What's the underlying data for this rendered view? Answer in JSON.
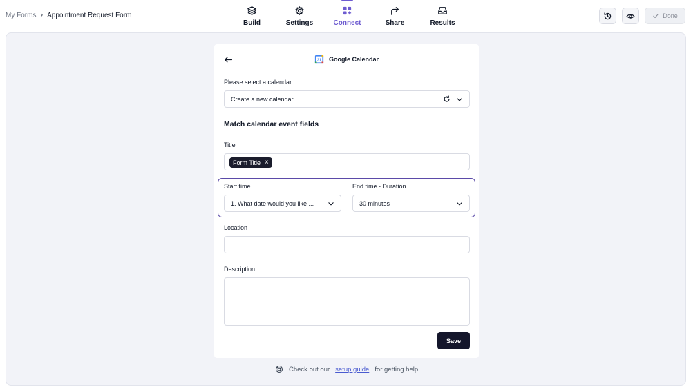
{
  "breadcrumb": {
    "root": "My Forms",
    "separator": "›",
    "current": "Appointment Request Form"
  },
  "nav": {
    "items": [
      {
        "label": "Build",
        "icon": "layers-icon"
      },
      {
        "label": "Settings",
        "icon": "gear-icon"
      },
      {
        "label": "Connect",
        "icon": "grid-plus-icon",
        "active": true
      },
      {
        "label": "Share",
        "icon": "share-arrow-icon"
      },
      {
        "label": "Results",
        "icon": "inbox-icon"
      }
    ],
    "accent_color": "#6d5bd0"
  },
  "toolbar": {
    "history_icon": "history-icon",
    "preview_icon": "eye-icon",
    "done_label": "Done"
  },
  "panel": {
    "title": "Google Calendar",
    "calendar_label": "Please select a calendar",
    "calendar_value": "Create a new calendar",
    "section_title": "Match calendar event fields",
    "title_label": "Title",
    "title_tag": "Form Title",
    "title_tag_remove": "×",
    "start_label": "Start time",
    "start_value": "1. What date would you like ...",
    "end_label": "End time - Duration",
    "end_value": "30 minutes",
    "location_label": "Location",
    "location_value": "",
    "description_label": "Description",
    "description_value": "",
    "save_label": "Save",
    "highlight_color": "#5b4aa8"
  },
  "help": {
    "prefix": "Check out our",
    "link": "setup guide",
    "suffix": "for getting help"
  }
}
